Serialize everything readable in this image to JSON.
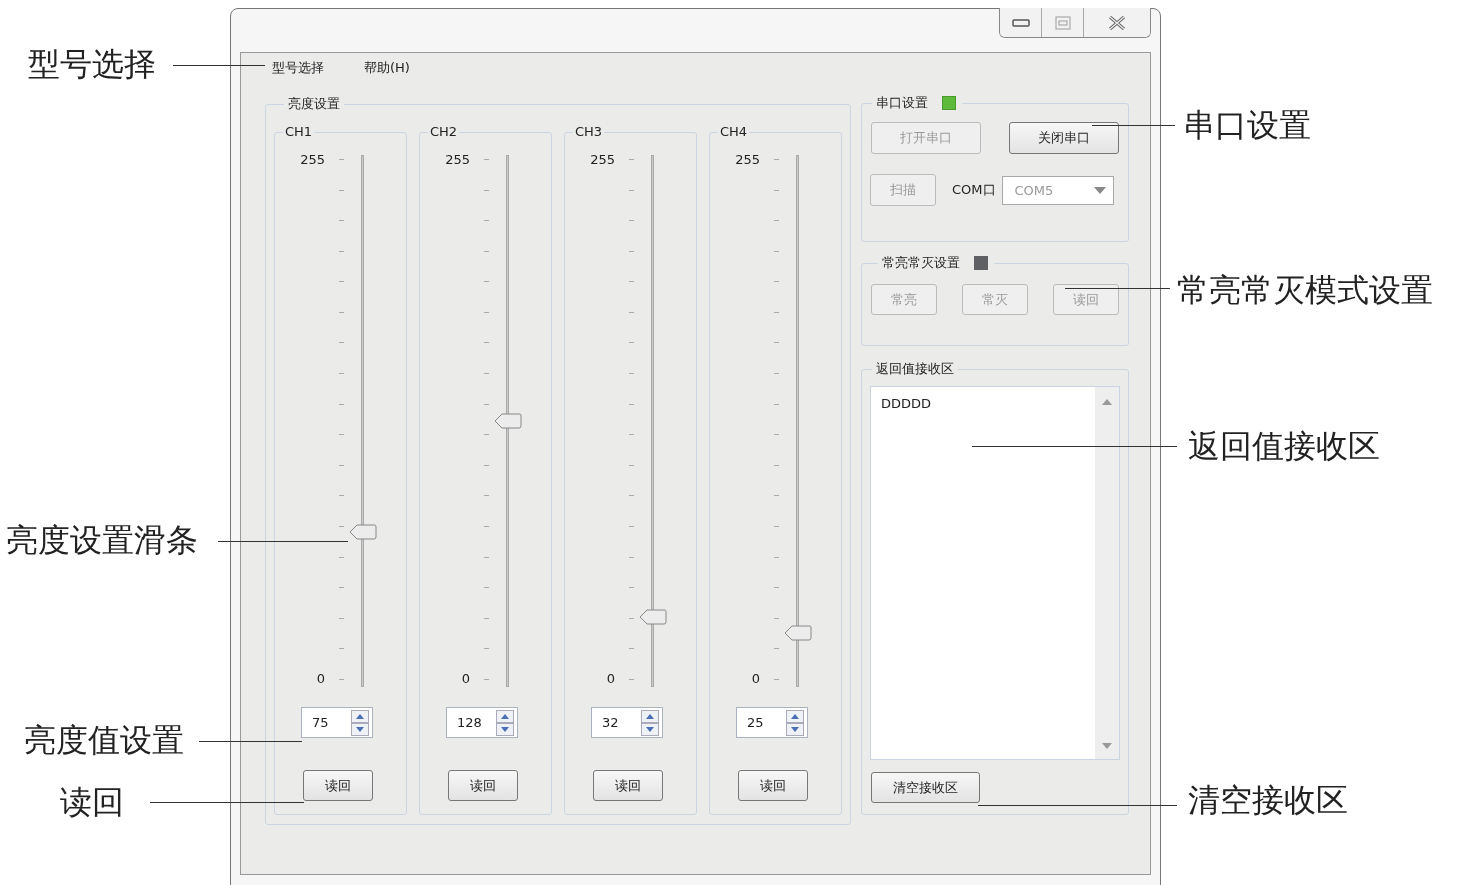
{
  "menu": [
    {
      "label": "型号选择"
    },
    {
      "label": "帮助(H)"
    }
  ],
  "brightness": {
    "title": "亮度设置",
    "channels": [
      {
        "name": "CH1",
        "max": "255",
        "min": "0",
        "level": 0.29,
        "value": "75",
        "read_button": "读回"
      },
      {
        "name": "CH2",
        "max": "255",
        "min": "0",
        "level": 0.5,
        "value": "128",
        "read_button": "读回"
      },
      {
        "name": "CH3",
        "max": "255",
        "min": "0",
        "level": 0.13,
        "value": "32",
        "read_button": "读回"
      },
      {
        "name": "CH4",
        "max": "255",
        "min": "0",
        "level": 0.1,
        "value": "25",
        "read_button": "读回"
      }
    ]
  },
  "serial": {
    "title": "串口设置",
    "on": true,
    "buttons": [
      {
        "label": "打开串口",
        "disabled": true
      },
      {
        "label": "关闭串口",
        "disabled": false
      }
    ],
    "scan_button": {
      "label": "扫描",
      "disabled": true
    },
    "port_label": "COM口",
    "port_select": {
      "value": "COM5",
      "disabled": true
    }
  },
  "mode": {
    "title": "常亮常灭设置",
    "on": false,
    "buttons": [
      {
        "label": "常亮",
        "disabled": true
      },
      {
        "label": "常灭",
        "disabled": true
      },
      {
        "label": "读回",
        "disabled": true
      }
    ]
  },
  "receive": {
    "title": "返回值接收区",
    "text": "DDDDD",
    "clear_button": "清空接收区"
  },
  "annotations": [
    "型号选择",
    "亮度设置滑条",
    "亮度值设置",
    "读回",
    "串口设置",
    "常亮常灭模式设置",
    "返回值接收区",
    "清空接收区"
  ]
}
